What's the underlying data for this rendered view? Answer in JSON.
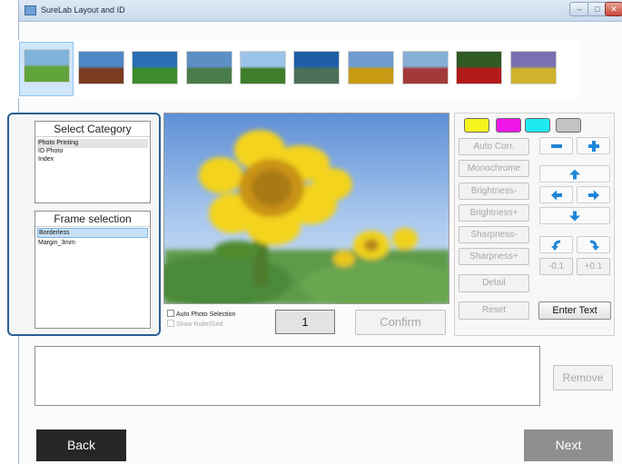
{
  "window": {
    "title": "SureLab Layout and ID",
    "controls": [
      "minimize",
      "maximize",
      "close"
    ]
  },
  "thumbnails": [
    {
      "name": "green field with tree",
      "top": "#7fb3d9",
      "bottom": "#5fa33a",
      "selected": true
    },
    {
      "name": "tree on red field",
      "top": "#4f86c6",
      "bottom": "#7a3c21"
    },
    {
      "name": "green hill blue sky",
      "top": "#2a6fb5",
      "bottom": "#3d8c2b"
    },
    {
      "name": "cloudy sky",
      "top": "#5e8fc4",
      "bottom": "#4a7c4a"
    },
    {
      "name": "poplar trees",
      "top": "#9bc4e8",
      "bottom": "#3f7d2a"
    },
    {
      "name": "sun and road",
      "top": "#1f5fa8",
      "bottom": "#4d6f5a"
    },
    {
      "name": "sunflower field",
      "top": "#6f9cd1",
      "bottom": "#c79a14"
    },
    {
      "name": "flower rows",
      "top": "#86aed6",
      "bottom": "#a33a3a"
    },
    {
      "name": "red poppies",
      "top": "#2f5a23",
      "bottom": "#b21a1a"
    },
    {
      "name": "yellow flowers",
      "top": "#7a6fb0",
      "bottom": "#d0b32c"
    }
  ],
  "select_category": {
    "title": "Select Category",
    "items": [
      "Photo Printing",
      "ID Photo",
      "Index"
    ],
    "selected_index": 0
  },
  "frame_selection": {
    "title": "Frame selection",
    "items": [
      "Borderless",
      "Margin_3mm"
    ],
    "selected_index": 0
  },
  "preview_options": {
    "auto_photo_selection": "Auto Photo Selection",
    "show_ruler_grid": "Show Ruler/Grid"
  },
  "page_number": "1",
  "confirm_label": "Confirm",
  "color_swatches": [
    {
      "name": "yellow",
      "color": "#f6f31e"
    },
    {
      "name": "magenta",
      "color": "#ee17e7"
    },
    {
      "name": "cyan",
      "color": "#1ee9f0"
    },
    {
      "name": "gray",
      "color": "#c4c4c4"
    }
  ],
  "adjust_buttons": {
    "auto_corr": "Auto Corr.",
    "monochrome": "Monochrome",
    "brightness_minus": "Brightness-",
    "brightness_plus": "Brightness+",
    "sharpness_minus": "Sharpness-",
    "sharpness_plus": "Sharpness+",
    "detail": "Detail",
    "reset": "Reset",
    "enter_text": "Enter Text",
    "rotate_minus": "-0.1",
    "rotate_plus": "+0.1"
  },
  "icon_accent": "#1f86d8",
  "remove_label": "Remove",
  "back_label": "Back",
  "next_label": "Next"
}
